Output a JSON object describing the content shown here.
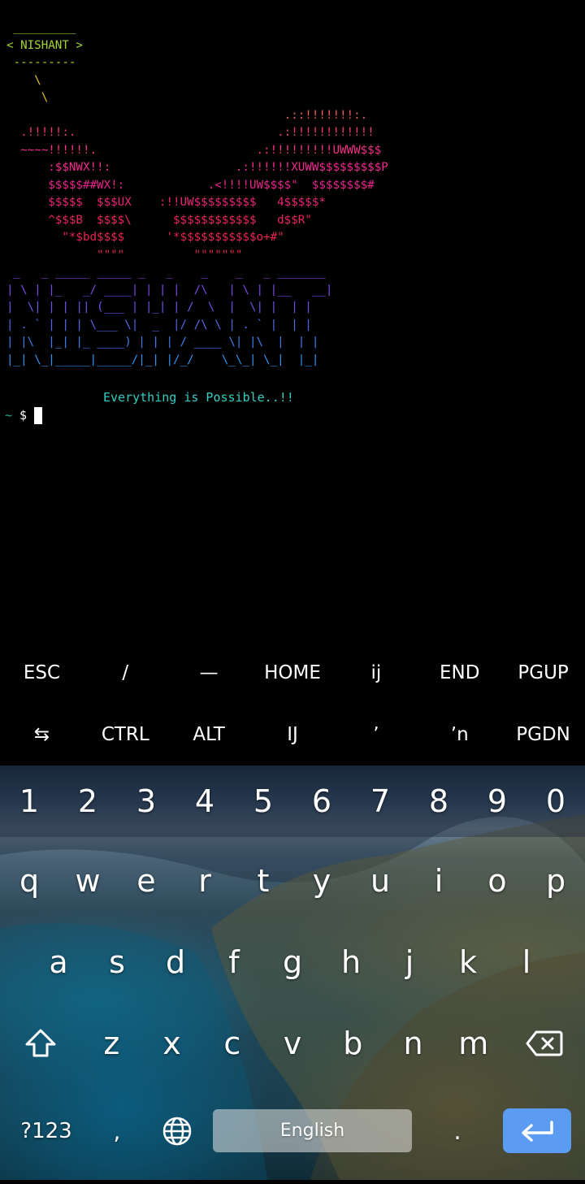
{
  "terminal": {
    "ascii_art": [
      {
        "text": " _________",
        "color": "#a3d62e"
      },
      {
        "text": "< NISHANT >",
        "color": "#a3d62e"
      },
      {
        "text": " ---------",
        "color": "#a3d62e"
      },
      {
        "text": "    \\",
        "color": "#e6c229"
      },
      {
        "text": "     \\",
        "color": "#e6c229"
      },
      {
        "text": "                                        .::!!!!!!!:.",
        "color": "#e85a5a"
      },
      {
        "text": "  .!!!!!:.                             .:!!!!!!!!!!!!",
        "color": "#ef3b6b"
      },
      {
        "text": "  ~~~~!!!!!!.                       .:!!!!!!!!!UWWW$$$",
        "color": "#f02f85"
      },
      {
        "text": "      :$$NWX!!:                  .:!!!!!!XUWW$$$$$$$$$P",
        "color": "#f0298f"
      },
      {
        "text": "      $$$$$##WX!:            .<!!!!UW$$$$\"  $$$$$$$$#",
        "color": "#e8238a"
      },
      {
        "text": "      $$$$$  $$$UX    :!!UW$$$$$$$$$   4$$$$$*",
        "color": "#e82375"
      },
      {
        "text": "      ^$$$B  $$$$\\      $$$$$$$$$$$$   d$$R\"",
        "color": "#e8235f"
      },
      {
        "text": "        \"*$bd$$$$      '*$$$$$$$$$$$o+#\"",
        "color": "#e8234f"
      },
      {
        "text": "             \"\"\"\"          \"\"\"\"\"\"\"",
        "color": "#d8234a"
      },
      {
        "text": " _   _ _____ _____ _   _    _    _   _ _______",
        "color": "#8b3fd9"
      },
      {
        "text": "| \\ | |_   _/ ____| | | |  /\\   | \\ | |__   __|",
        "color": "#7b48e0"
      },
      {
        "text": "|  \\| | | || (___ | |_| | /  \\  |  \\| |  | |",
        "color": "#6a55e6"
      },
      {
        "text": "| . ` | | | \\___ \\|  _  |/ /\\ \\ | . ` |  | |",
        "color": "#5466ea"
      },
      {
        "text": "| |\\  |_| |_ ____) | | | / ____ \\| |\\  |  | |",
        "color": "#3f7ded"
      },
      {
        "text": "|_| \\_|_____|_____/|_| |/_/    \\_\\_| \\_|  |_|",
        "color": "#2d94ee"
      }
    ],
    "motto": "Everything is Possible..!!",
    "prompt_tilde": "~",
    "prompt_symbol": "$"
  },
  "extra_keys": {
    "row1": [
      "ESC",
      "/",
      "—",
      "HOME",
      "ĳ",
      "END",
      "PGUP"
    ],
    "row2": [
      "⇆",
      "CTRL",
      "ALT",
      "Ĳ",
      "ʼ",
      "ʼn",
      "PGDN"
    ]
  },
  "keyboard": {
    "numbers": [
      "1",
      "2",
      "3",
      "4",
      "5",
      "6",
      "7",
      "8",
      "9",
      "0"
    ],
    "row_q": [
      "q",
      "w",
      "e",
      "r",
      "t",
      "y",
      "u",
      "i",
      "o",
      "p"
    ],
    "row_a": [
      "a",
      "s",
      "d",
      "f",
      "g",
      "h",
      "j",
      "k",
      "l"
    ],
    "row_z": [
      "z",
      "x",
      "c",
      "v",
      "b",
      "n",
      "m"
    ],
    "symbols_label": "?123",
    "comma": ",",
    "space_label": "English",
    "period": ".",
    "shift_icon": "shift-icon",
    "backspace_icon": "backspace-icon",
    "globe_icon": "globe-icon",
    "enter_icon": "enter-icon",
    "accent_color": "#5b9cf2"
  }
}
